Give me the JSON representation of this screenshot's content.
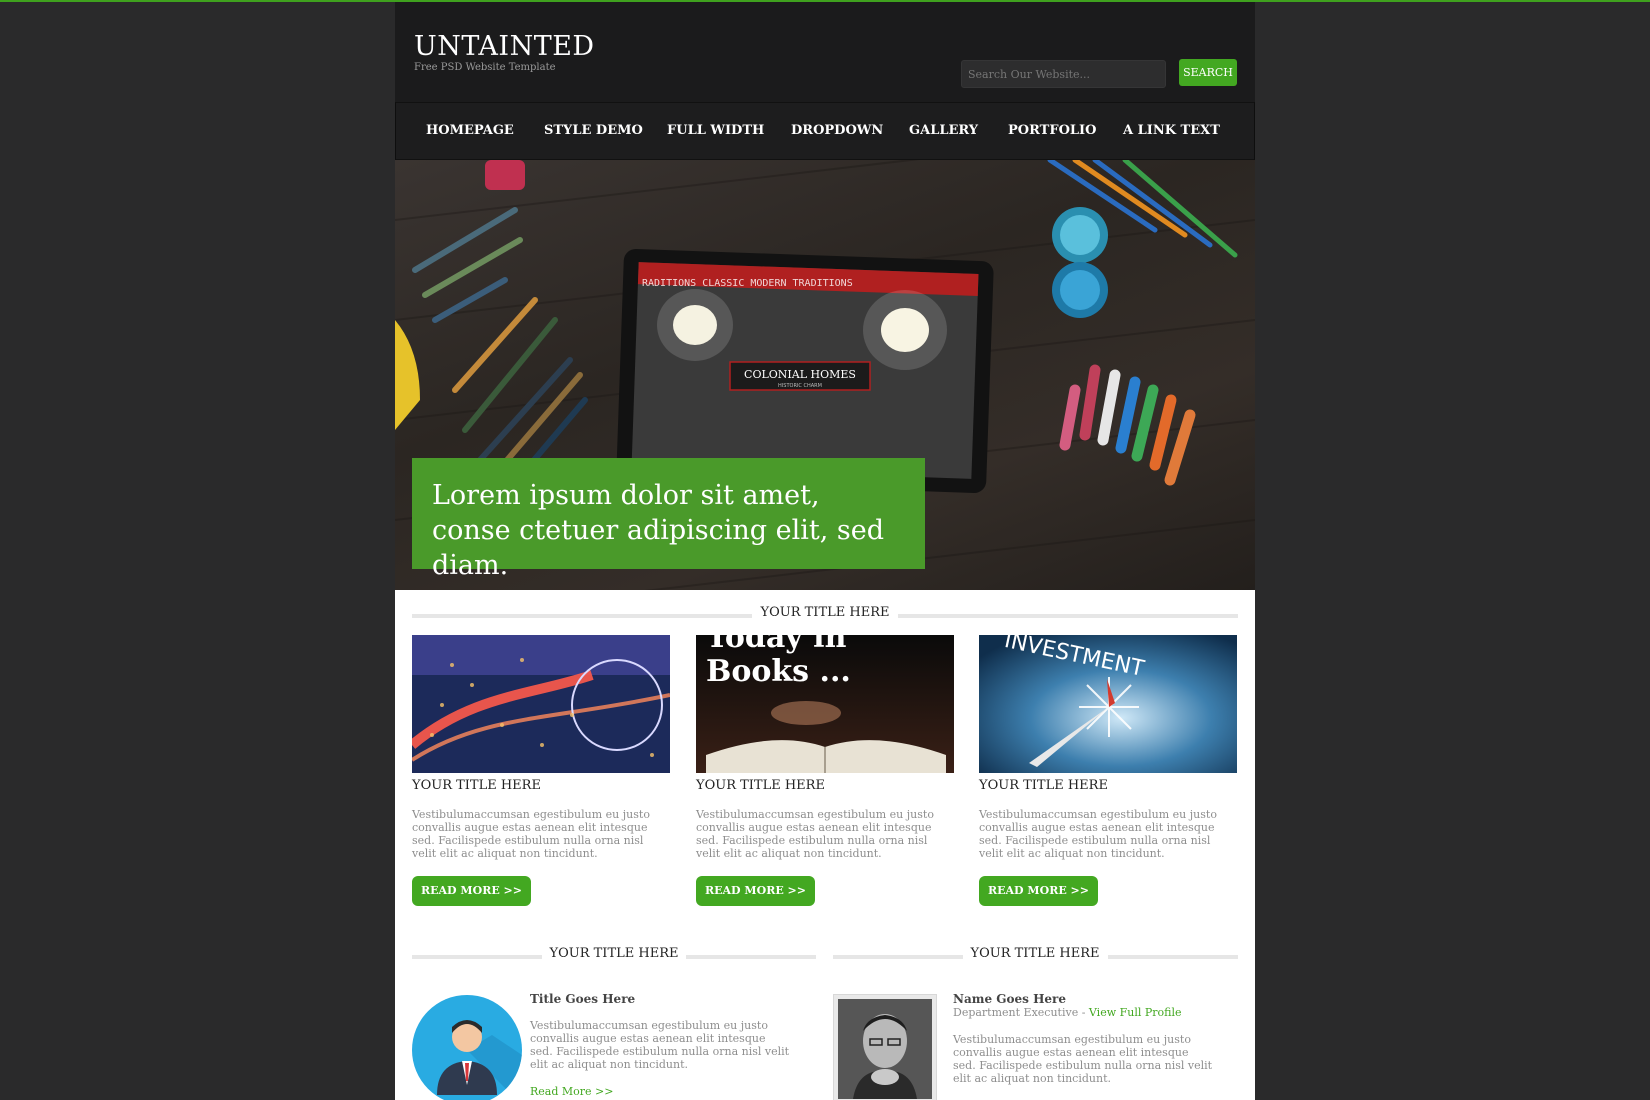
{
  "brand": {
    "title": "UNTAINTED",
    "subtitle": "Free PSD Website Template"
  },
  "search": {
    "placeholder": "Search Our Website...",
    "button_label": "SEARCH"
  },
  "nav": {
    "items": [
      {
        "label": "HOMEPAGE"
      },
      {
        "label": "STYLE DEMO"
      },
      {
        "label": "FULL WIDTH"
      },
      {
        "label": "DROPDOWN"
      },
      {
        "label": "GALLERY"
      },
      {
        "label": "PORTFOLIO"
      },
      {
        "label": "A LINK TEXT"
      }
    ]
  },
  "hero": {
    "caption": "Lorem ipsum dolor sit amet, conse ctetuer adipiscing elit, sed diam.",
    "tablet_sign": "COLONIAL HOMES",
    "tablet_sign_sub": "HISTORIC CHARM",
    "tablet_banner": "RADITIONS CLASSIC MODERN TRADITIONS"
  },
  "features": {
    "section_title": "YOUR TITLE HERE",
    "cards": [
      {
        "title": "YOUR TITLE HERE",
        "text": "Vestibulumaccumsan egestibulum eu justo convallis augue estas aenean elit intesque sed. Facilispede estibulum nulla orna nisl velit elit ac aliquat non tincidunt.",
        "button": "READ MORE >>",
        "image": "city-night-ferris-wheel"
      },
      {
        "title": "YOUR TITLE HERE",
        "text": "Vestibulumaccumsan egestibulum eu justo convallis augue estas aenean elit intesque sed. Facilispede estibulum nulla orna nisl velit elit ac aliquat non tincidunt.",
        "button": "READ MORE >>",
        "image": "open-book",
        "image_text_1": "Today in",
        "image_text_2": "Books ..."
      },
      {
        "title": "YOUR TITLE HERE",
        "text": "Vestibulumaccumsan egestibulum eu justo convallis augue estas aenean elit intesque sed. Facilispede estibulum nulla orna nisl velit elit ac aliquat non tincidunt.",
        "button": "READ MORE >>",
        "image": "investment-compass",
        "image_text": "INVESTMENT"
      }
    ]
  },
  "bottom_left": {
    "section_title": "YOUR TITLE HERE",
    "title": "Title Goes Here",
    "text": "Vestibulumaccumsan egestibulum eu justo convallis augue estas aenean elit intesque sed. Facilispede estibulum nulla orna nisl velit elit ac aliquat non tincidunt.",
    "link": "Read More >>"
  },
  "bottom_right": {
    "section_title": "YOUR TITLE HERE",
    "name": "Name Goes Here",
    "department": "Department Executive - ",
    "profile_link": "View Full Profile",
    "text": "Vestibulumaccumsan egestibulum eu justo convallis augue estas aenean elit intesque sed. Facilispede estibulum nulla orna nisl velit elit ac aliquat non tincidunt."
  },
  "colors": {
    "accent": "#43a821",
    "caption_bg": "#4a9a2a",
    "page_bg": "#2a2a2b",
    "header_bg": "#1b1b1c"
  }
}
